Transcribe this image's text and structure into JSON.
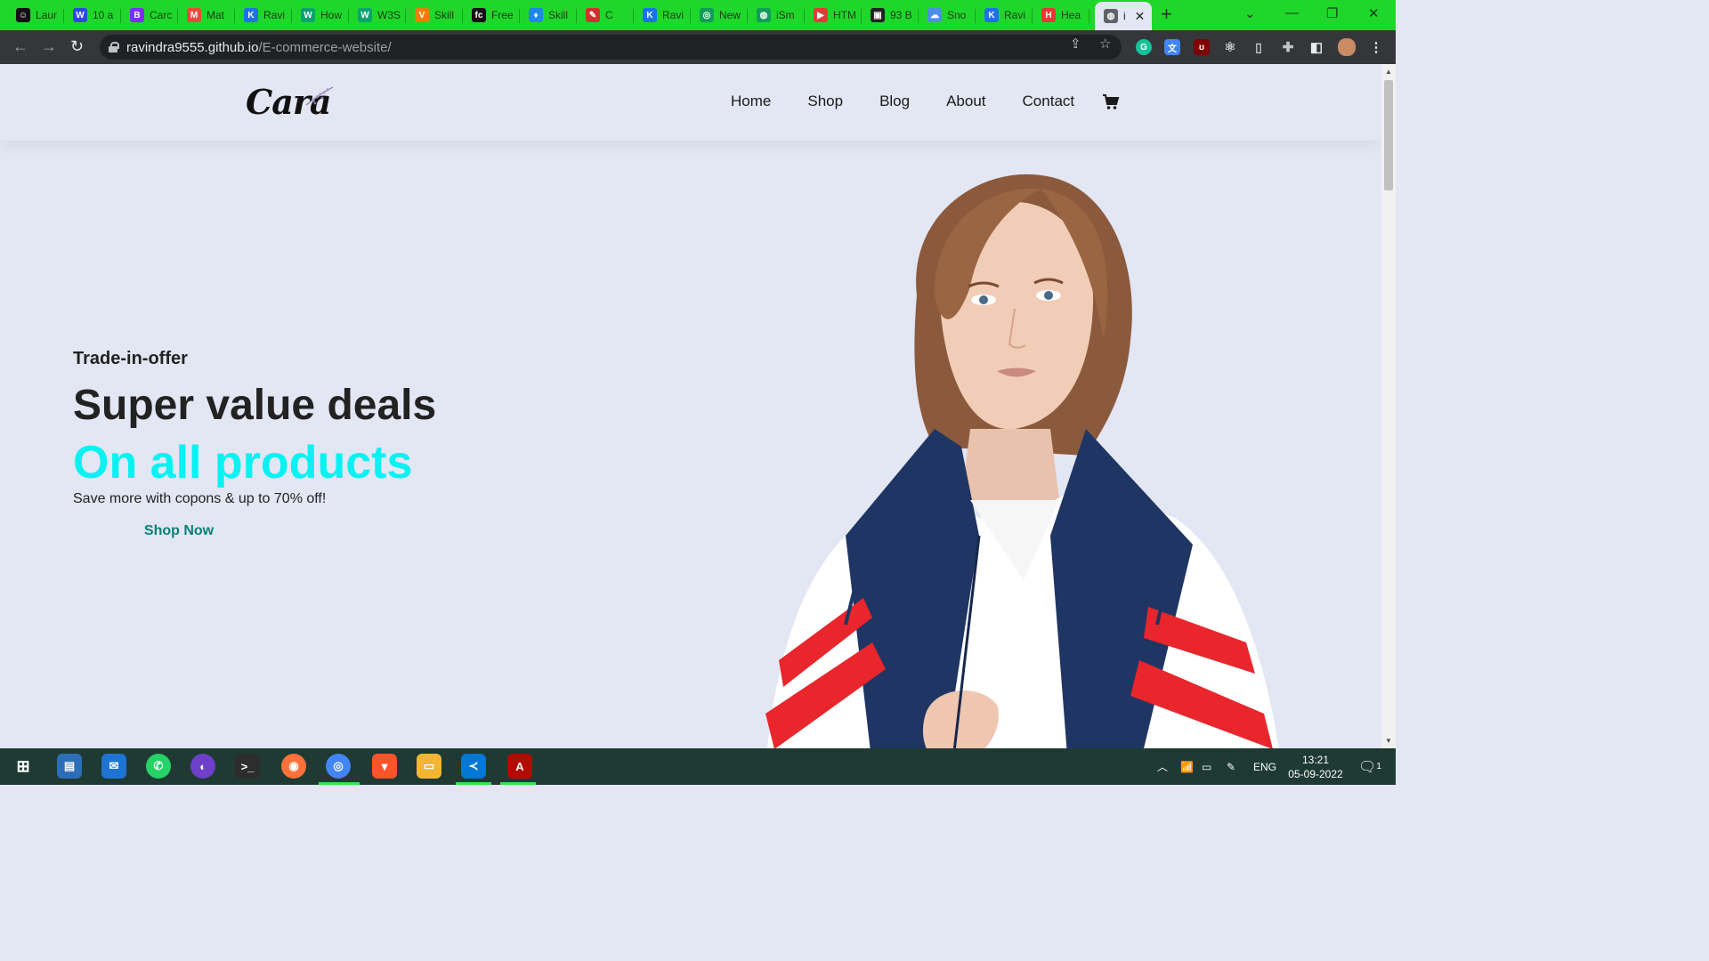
{
  "browser": {
    "tabs": [
      {
        "label": "Laur",
        "fav_color": "#111111",
        "fav_glyph": "☺"
      },
      {
        "label": "10 a",
        "fav_color": "#2a4bd7",
        "fav_glyph": "W"
      },
      {
        "label": "Carc",
        "fav_color": "#7b2ff7",
        "fav_glyph": "B"
      },
      {
        "label": "Mat",
        "fav_color": "#e84a3c",
        "fav_glyph": "M"
      },
      {
        "label": "Ravi",
        "fav_color": "#1a73e8",
        "fav_glyph": "K"
      },
      {
        "label": "How",
        "fav_color": "#0aa36e",
        "fav_glyph": "W"
      },
      {
        "label": "W3S",
        "fav_color": "#0aa36e",
        "fav_glyph": "W"
      },
      {
        "label": "Skill",
        "fav_color": "#f57c00",
        "fav_glyph": "V"
      },
      {
        "label": "Free",
        "fav_color": "#111111",
        "fav_glyph": "fc"
      },
      {
        "label": "Skill",
        "fav_color": "#1e88e5",
        "fav_glyph": "♦"
      },
      {
        "label": "C",
        "fav_color": "#d32f2f",
        "fav_glyph": "✎"
      },
      {
        "label": "Ravi",
        "fav_color": "#1a73e8",
        "fav_glyph": "K"
      },
      {
        "label": "New",
        "fav_color": "#0f9d58",
        "fav_glyph": "◎"
      },
      {
        "label": "iSm",
        "fav_color": "#0f9d58",
        "fav_glyph": "◍"
      },
      {
        "label": "HTM",
        "fav_color": "#e53935",
        "fav_glyph": "▶"
      },
      {
        "label": "93 B",
        "fav_color": "#222222",
        "fav_glyph": "▣"
      },
      {
        "label": "Sno",
        "fav_color": "#4a90e2",
        "fav_glyph": "☁"
      },
      {
        "label": "Ravi",
        "fav_color": "#1a73e8",
        "fav_glyph": "K"
      },
      {
        "label": "Hea",
        "fav_color": "#e53935",
        "fav_glyph": "H"
      }
    ],
    "active_tab": {
      "label": "i",
      "fav_glyph": "◍"
    },
    "url_host": "ravindra9555.github.io",
    "url_path": "/E-commerce-website/"
  },
  "site": {
    "nav": [
      "Home",
      "Shop",
      "Blog",
      "About",
      "Contact"
    ],
    "hero": {
      "offer": "Trade-in-offer",
      "headline": "Super value deals",
      "headline_accent": "On all products",
      "tagline": "Save more with copons & up to 70% off!",
      "cta": "Shop Now"
    },
    "colors": {
      "background": "#e3e6f3",
      "accent": "#08f2f2",
      "cta_text": "#088178",
      "cta_brush": "#f3d8b8"
    }
  },
  "taskbar": {
    "language": "ENG",
    "time": "13:21",
    "date": "05-09-2022",
    "notifications": "1"
  }
}
